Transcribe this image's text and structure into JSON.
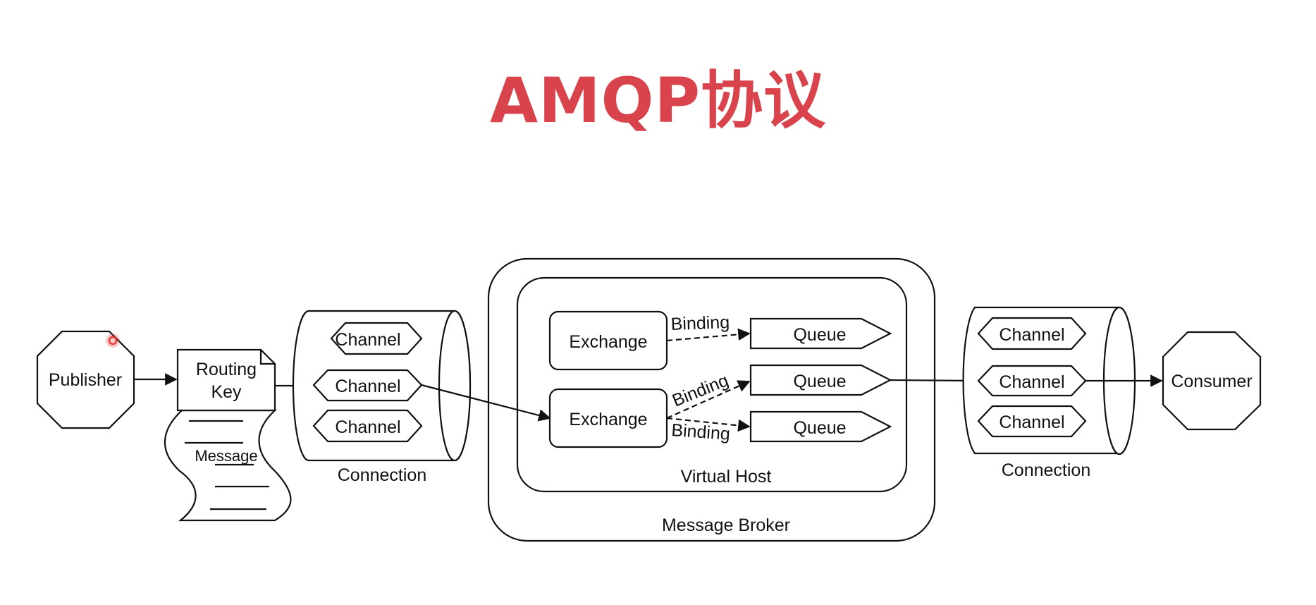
{
  "title": "AMQP协议",
  "colors": {
    "title": "#d9434b",
    "stroke": "#111111",
    "cursor": "#e53935"
  },
  "diagram": {
    "publisher": "Publisher",
    "consumer": "Consumer",
    "routing_key_line1": "Routing",
    "routing_key_line2": "Key",
    "message": "Message",
    "channel": "Channel",
    "connection": "Connection",
    "exchange": "Exchange",
    "binding": "Binding",
    "queue": "Queue",
    "virtual_host": "Virtual Host",
    "message_broker": "Message Broker"
  }
}
